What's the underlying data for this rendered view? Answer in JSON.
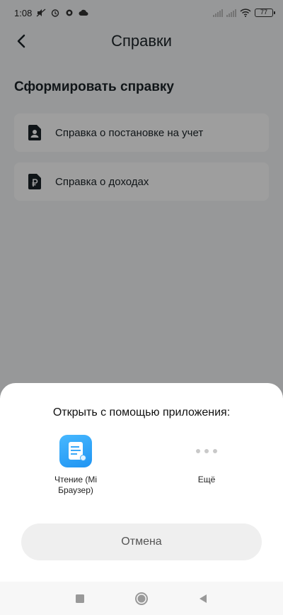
{
  "status_bar": {
    "time": "1:08",
    "battery_level": "77"
  },
  "header": {
    "title": "Справки"
  },
  "section": {
    "title": "Сформировать справку",
    "items": [
      {
        "label": "Справка о постановке на учет",
        "icon": "person-document-icon"
      },
      {
        "label": "Справка о доходах",
        "icon": "ruble-document-icon"
      }
    ]
  },
  "share_sheet": {
    "title": "Открыть с помощью приложения:",
    "apps": [
      {
        "label": "Чтение (Mi Браузер)",
        "icon": "mi-reader-icon"
      },
      {
        "label": "Ещё",
        "icon": "more-dots-icon"
      }
    ],
    "cancel_label": "Отмена"
  },
  "colors": {
    "primary_text": "#1b2227",
    "sheet_bg": "#ffffff",
    "reader_accent": "#1f94f2",
    "cancel_bg": "#efefef"
  }
}
